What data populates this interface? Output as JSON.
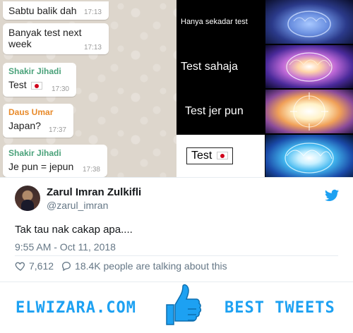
{
  "meme": {
    "chat": [
      {
        "sender": "",
        "text": "Sabtu balik dah",
        "time": "17:13"
      },
      {
        "sender": "",
        "text": "Banyak test next week",
        "time": "17:13"
      },
      {
        "sender": "Shakir Jihadi",
        "sender_color": "#4aa27a",
        "text": "Test",
        "flag": "jp-flag-icon",
        "time": "17:30"
      },
      {
        "sender": "Daus Umar",
        "sender_color": "#e88a2a",
        "text": "Japan?",
        "time": "17:37"
      },
      {
        "sender": "Shakir Jihadi",
        "sender_color": "#4aa27a",
        "text": "Je pun = jepun",
        "time": "17:38"
      }
    ],
    "panels": [
      {
        "label": "Hanya sekadar test"
      },
      {
        "label": "Test sahaja"
      },
      {
        "label": "Test jer pun"
      },
      {
        "label": "Test",
        "flag": "jp-flag-icon"
      }
    ]
  },
  "tweet": {
    "display_name": "Zarul Imran Zulkifli",
    "handle": "@zarul_imran",
    "text": "Tak tau nak cakap apa....",
    "timestamp": "9:55 AM - Oct 11, 2018",
    "likes": "7,612",
    "talking": "18.4K people are talking about this",
    "accent": "#1da1f2"
  },
  "footer": {
    "left": "ELWIZARA.COM",
    "right": "BEST TWEETS",
    "icon": "thumbs-up-icon"
  }
}
